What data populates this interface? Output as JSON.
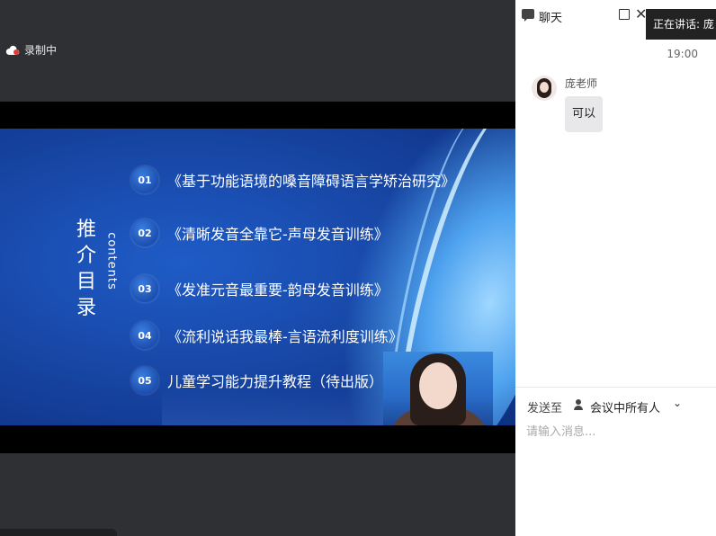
{
  "recording": {
    "label": "录制中"
  },
  "slide": {
    "title_chars": [
      "推",
      "介",
      "目",
      "录"
    ],
    "subtitle": "contents",
    "items": [
      {
        "num": "01",
        "text": "《基于功能语境的嗓音障碍语言学矫治研究》"
      },
      {
        "num": "02",
        "text": "《清晰发音全靠它-声母发音训练》"
      },
      {
        "num": "03",
        "text": "《发准元音最重要-韵母发音训练》"
      },
      {
        "num": "04",
        "text": "《流利说话我最棒-言语流利度训练》"
      },
      {
        "num": "05",
        "text": "儿童学习能力提升教程（待出版）"
      }
    ]
  },
  "chat": {
    "title": "聊天",
    "speaker_tip": "正在讲话: 庞",
    "time": "19:00",
    "messages": [
      {
        "sender": "庞老师",
        "text": "可以"
      }
    ],
    "send_to_label": "发送至",
    "send_to_value": "会议中所有人",
    "input_placeholder": "请输入消息..."
  },
  "colors": {
    "slide_blue": "#1848a8",
    "panel_bg": "#ffffff",
    "video_bg": "#2e3033"
  }
}
